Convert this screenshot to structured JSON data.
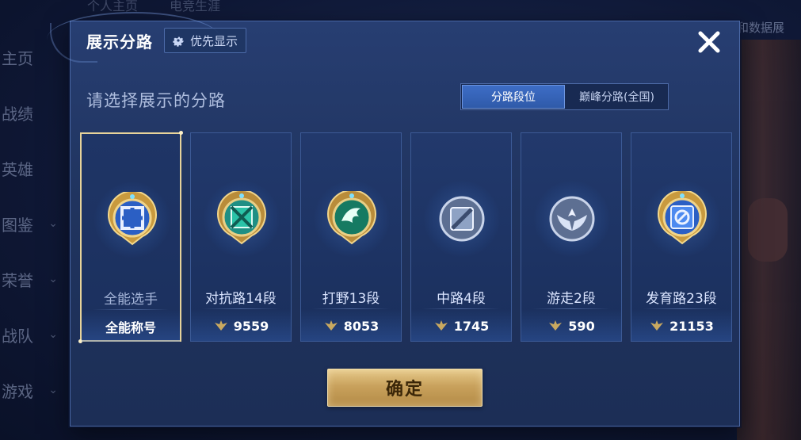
{
  "background": {
    "top_tabs": [
      "个人主页",
      "电竞生涯"
    ],
    "right_text": "和数据展",
    "sidebar": [
      {
        "label": "主页",
        "chevron": false
      },
      {
        "label": "战绩",
        "chevron": false
      },
      {
        "label": "英雄",
        "chevron": false
      },
      {
        "label": "图鉴",
        "chevron": true
      },
      {
        "label": "荣誉",
        "chevron": true
      },
      {
        "label": "战队",
        "chevron": true
      },
      {
        "label": "游戏",
        "chevron": true
      }
    ]
  },
  "dialog": {
    "title": "展示分路",
    "priority_button": "优先显示",
    "subtitle": "请选择展示的分路",
    "toggle": {
      "options": [
        "分路段位",
        "巅峰分路(全国)"
      ],
      "selected": "分路段位"
    },
    "confirm_label": "确定"
  },
  "lanes": [
    {
      "name": "全能选手",
      "value": "全能称号",
      "selected": true,
      "emblem": "all-round-emblem-icon",
      "color": "#3f7be0"
    },
    {
      "name": "对抗路14段",
      "value": "9559",
      "selected": false,
      "emblem": "clash-lane-emblem-icon",
      "color": "#2ab9a0"
    },
    {
      "name": "打野13段",
      "value": "8053",
      "selected": false,
      "emblem": "jungle-emblem-icon",
      "color": "#1e9a7a"
    },
    {
      "name": "中路4段",
      "value": "1745",
      "selected": false,
      "emblem": "mid-lane-emblem-icon",
      "color": "#8ea2c4"
    },
    {
      "name": "游走2段",
      "value": "590",
      "selected": false,
      "emblem": "roam-emblem-icon",
      "color": "#8ea2c4"
    },
    {
      "name": "发育路23段",
      "value": "21153",
      "selected": false,
      "emblem": "farm-lane-emblem-icon",
      "color": "#3f7be0"
    }
  ],
  "colors": {
    "gold": "#e7d39a",
    "accent_blue": "#3d6dc6",
    "panel": "#22396c"
  }
}
